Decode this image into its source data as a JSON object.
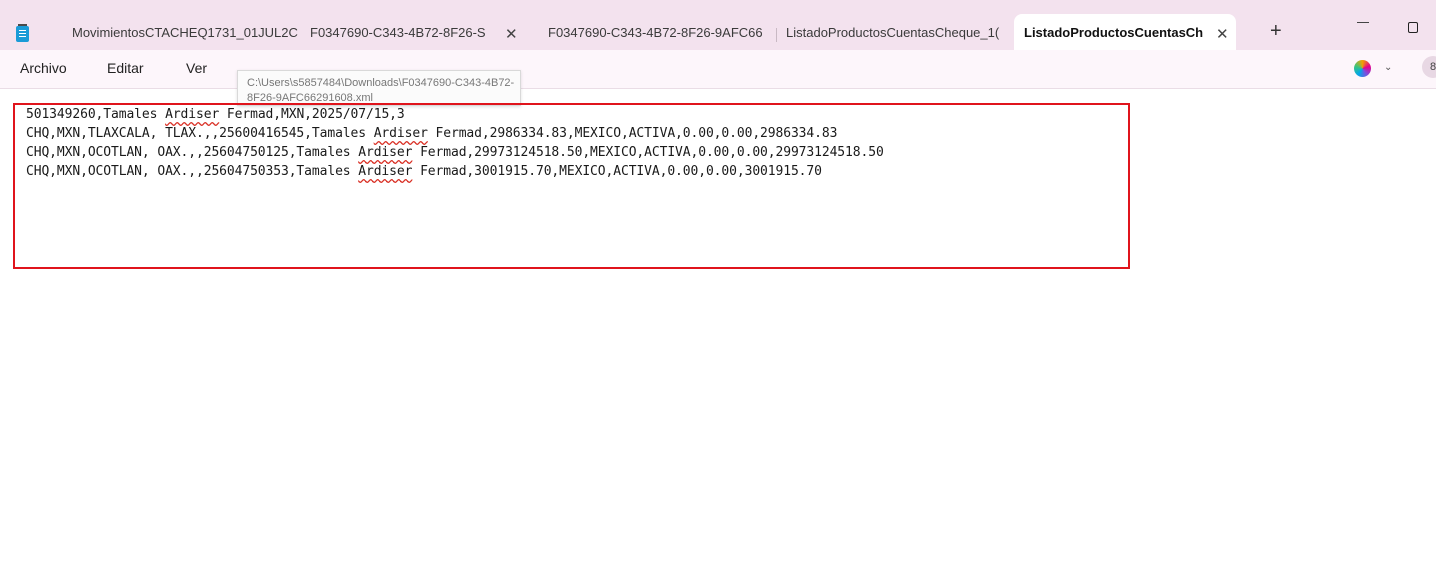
{
  "tabs": [
    {
      "label": "MovimientosCTACHEQ1731_01JUL2C"
    },
    {
      "label": "F0347690-C343-4B72-8F26-S"
    },
    {
      "label": "F0347690-C343-4B72-8F26-9AFC66"
    },
    {
      "label": "ListadoProductosCuentasCheque_1("
    },
    {
      "label": "ListadoProductosCuentasCh"
    }
  ],
  "tab_close_glyph": "✕",
  "new_tab_label": "+",
  "menu": {
    "file": "Archivo",
    "edit": "Editar",
    "view": "Ver"
  },
  "tooltip": "C:\\Users\\s5857484\\Downloads\\F0347690-C343-4B72-8F26-9AFC66291608.xml",
  "account_initial": "8",
  "lines": [
    {
      "pre": "501349260,Tamales ",
      "sq": "Ardiser",
      "post": " Fermad,MXN,2025/07/15,3"
    },
    {
      "pre": "CHQ,MXN,TLAXCALA, TLAX.,,25600416545,Tamales ",
      "sq": "Ardiser",
      "post": " Fermad,2986334.83,MEXICO,ACTIVA,0.00,0.00,2986334.83"
    },
    {
      "pre": "CHQ,MXN,OCOTLAN, OAX.,,25604750125,Tamales ",
      "sq": "Ardiser",
      "post": " Fermad,29973124518.50,MEXICO,ACTIVA,0.00,0.00,29973124518.50"
    },
    {
      "pre": "CHQ,MXN,OCOTLAN, OAX.,,25604750353,Tamales ",
      "sq": "Ardiser",
      "post": " Fermad,3001915.70,MEXICO,ACTIVA,0.00,0.00,3001915.70"
    }
  ],
  "colors": {
    "tab_bar": "#f3e2ee",
    "menu_bar": "#fdf6fb",
    "highlight_border": "#e0141c",
    "spell_squiggle": "#d93025"
  },
  "icons": [
    "notepad-app-icon",
    "close-icon",
    "minimize-icon",
    "maximize-icon",
    "copilot-icon",
    "chevron-down-icon",
    "account-icon"
  ]
}
